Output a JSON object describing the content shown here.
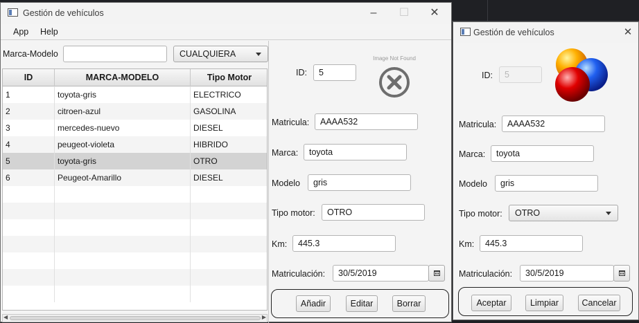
{
  "main_window": {
    "title": "Gestión de vehículos",
    "menu": [
      "App",
      "Help"
    ],
    "filter": {
      "label": "Marca-Modelo",
      "value": "",
      "motor_filter": "CUALQUIERA"
    },
    "table": {
      "columns": [
        "ID",
        "MARCA-MODELO",
        "Tipo Motor"
      ],
      "rows": [
        [
          "1",
          "toyota-gris",
          "ELECTRICO"
        ],
        [
          "2",
          "citroen-azul",
          "GASOLINA"
        ],
        [
          "3",
          "mercedes-nuevo",
          "DIESEL"
        ],
        [
          "4",
          "peugeot-violeta",
          "HIBRIDO"
        ],
        [
          "5",
          "toyota-gris",
          "OTRO"
        ],
        [
          "6",
          "Peugeot-Amarillo",
          "DIESEL"
        ]
      ],
      "selected_row": 5
    },
    "form": {
      "id_label": "ID:",
      "id_value": "5",
      "image_text": "Image Not Found",
      "matricula_label": "Matricula:",
      "matricula_value": "AAAA532",
      "marca_label": "Marca:",
      "marca_value": "toyota",
      "modelo_label": "Modelo",
      "modelo_value": "gris",
      "tipo_label": "Tipo motor:",
      "tipo_value": "OTRO",
      "km_label": "Km:",
      "km_value": "445.3",
      "fecha_label": "Matriculación:",
      "fecha_value": "30/5/2019"
    },
    "buttons": {
      "add": "Añadir",
      "edit": "Editar",
      "delete": "Borrar"
    }
  },
  "dialog": {
    "title": "Gestión de vehículos",
    "id_label": "ID:",
    "id_value": "5",
    "matricula_label": "Matricula:",
    "matricula_value": "AAAA532",
    "marca_label": "Marca:",
    "marca_value": "toyota",
    "modelo_label": "Modelo",
    "modelo_value": "gris",
    "tipo_label": "Tipo motor:",
    "tipo_value": "OTRO",
    "km_label": "Km:",
    "km_value": "445.3",
    "fecha_label": "Matriculación:",
    "fecha_value": "30/5/2019",
    "buttons": {
      "accept": "Aceptar",
      "clear": "Limpiar",
      "cancel": "Cancelar"
    }
  },
  "icons": {
    "minimize": "minimize-icon",
    "maximize": "maximize-icon",
    "close": "close-icon",
    "image_not_found": "broken-image-icon",
    "calendar": "calendar-icon",
    "dropdown": "chevron-down-icon",
    "dialog_image": "colored-balls-image"
  },
  "colors": {
    "selected_row": "#d3d3d3",
    "ball_orange": "#ff9a00",
    "ball_blue": "#1a4fe0",
    "ball_red": "#e00000"
  }
}
